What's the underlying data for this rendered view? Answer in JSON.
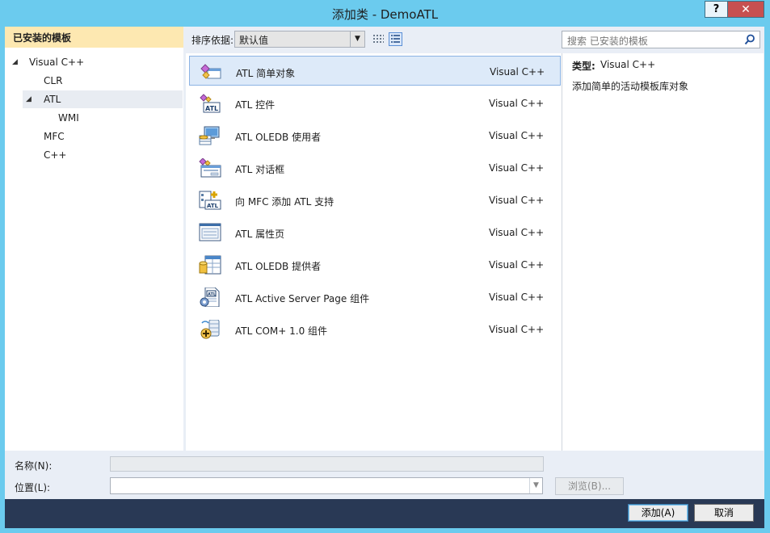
{
  "window": {
    "title": "添加类 - DemoATL",
    "help_label": "?",
    "close_label": "✕"
  },
  "left": {
    "header": "已安装的模板",
    "tree": [
      {
        "label": "Visual C++",
        "expanded": true,
        "level": 0
      },
      {
        "label": "CLR",
        "level": 1
      },
      {
        "label": "ATL",
        "expanded": true,
        "selected": true,
        "level": 1
      },
      {
        "label": "WMI",
        "level": 2
      },
      {
        "label": "MFC",
        "level": 1
      },
      {
        "label": "C++",
        "level": 1
      }
    ]
  },
  "toolbar": {
    "sort_label": "排序依据:",
    "sort_value": "默认值"
  },
  "search": {
    "placeholder": "搜索 已安装的模板"
  },
  "templates": [
    {
      "name": "ATL 简单对象",
      "lang": "Visual C++",
      "icon": "atl-simple-object-icon",
      "selected": true
    },
    {
      "name": "ATL 控件",
      "lang": "Visual C++",
      "icon": "atl-control-icon"
    },
    {
      "name": "ATL OLEDB 使用者",
      "lang": "Visual C++",
      "icon": "oledb-consumer-icon"
    },
    {
      "name": "ATL 对话框",
      "lang": "Visual C++",
      "icon": "atl-dialog-icon"
    },
    {
      "name": "向 MFC 添加 ATL 支持",
      "lang": "Visual C++",
      "icon": "add-atl-support-icon"
    },
    {
      "name": "ATL 属性页",
      "lang": "Visual C++",
      "icon": "property-page-icon"
    },
    {
      "name": "ATL OLEDB 提供者",
      "lang": "Visual C++",
      "icon": "oledb-provider-icon"
    },
    {
      "name": "ATL Active Server Page 组件",
      "lang": "Visual C++",
      "icon": "asp-component-icon"
    },
    {
      "name": "ATL COM+ 1.0 组件",
      "lang": "Visual C++",
      "icon": "complus-component-icon"
    }
  ],
  "details": {
    "type_label": "类型:",
    "type_value": "Visual C++",
    "description": "添加简单的活动模板库对象"
  },
  "form": {
    "name_label": "名称(N):",
    "name_value": "",
    "location_label": "位置(L):",
    "location_value": "",
    "browse_label": "浏览(B)..."
  },
  "buttons": {
    "add": "添加(A)",
    "cancel": "取消"
  },
  "colors": {
    "titlebar": "#6bcbee",
    "footer": "#293955",
    "selection": "#ddeaf9",
    "header": "#fde8b1"
  }
}
